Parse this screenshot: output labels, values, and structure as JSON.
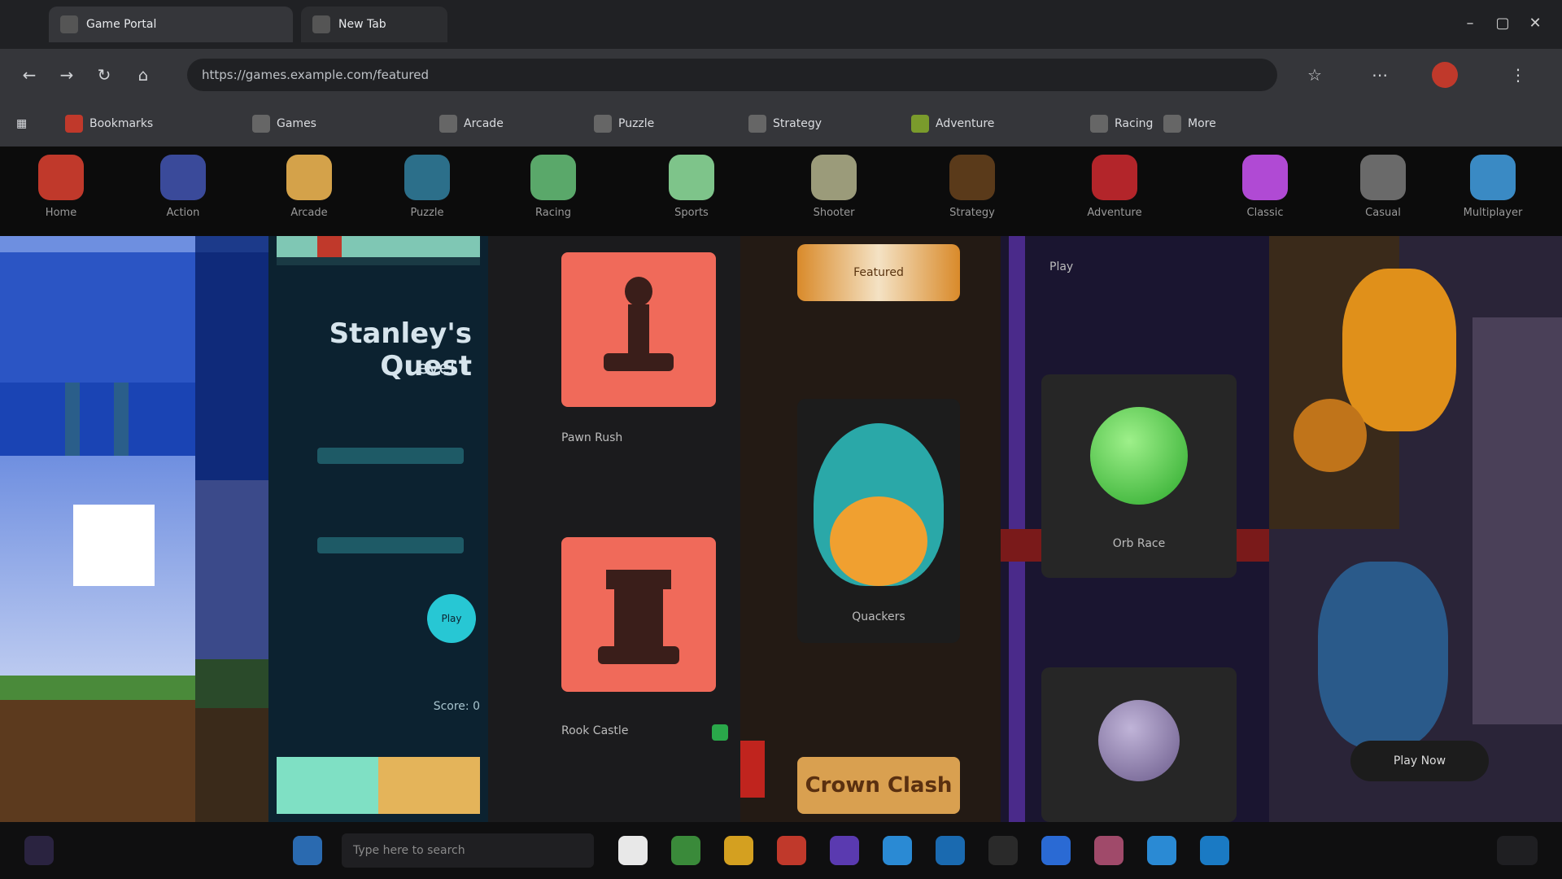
{
  "browser": {
    "tabs": [
      {
        "title": "Game Portal"
      },
      {
        "title": "New Tab"
      }
    ],
    "address": "https://games.example.com/featured",
    "bookmarks": [
      "Bookmarks",
      "Games",
      "Arcade",
      "Puzzle",
      "Strategy",
      "Adventure",
      "Racing",
      "More"
    ]
  },
  "gamebar": {
    "items": [
      "Home",
      "Action",
      "Arcade",
      "Puzzle",
      "Racing",
      "Sports",
      "Shooter",
      "Strategy",
      "Adventure",
      "Classic",
      "Casual",
      "Multiplayer"
    ]
  },
  "panels": {
    "puzzle": {
      "title": "Stanley's Quest",
      "subtitle": "Level 1",
      "score_label": "Score: 0",
      "play_label": "Play"
    },
    "chess": {
      "pawn_label": "Pawn Rush",
      "rook_label": "Rook Castle"
    },
    "bird": {
      "banner": "Featured",
      "label": "Quackers",
      "footer": "Crown Clash"
    },
    "orb": {
      "label": "Orb Race",
      "play_label": "Play"
    },
    "fantasy": {
      "play_now": "Play Now"
    }
  },
  "taskbar": {
    "search_placeholder": "Type here to search"
  }
}
